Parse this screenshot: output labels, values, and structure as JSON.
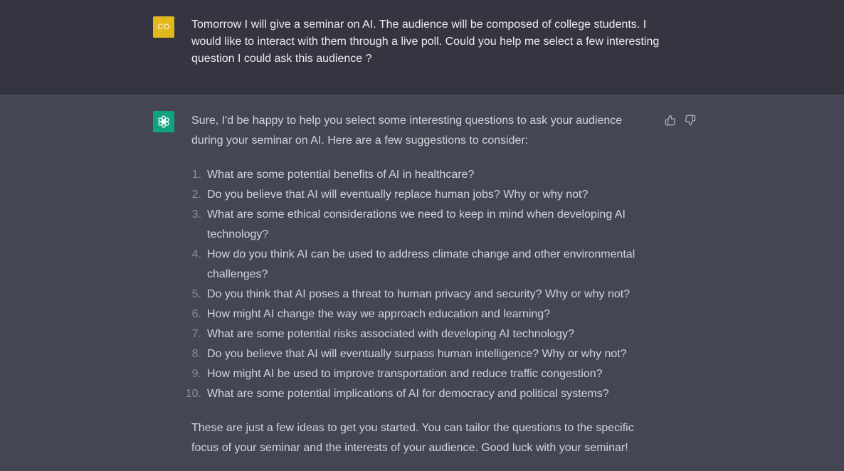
{
  "user_message": {
    "avatar_initials": "CO",
    "avatar_color": "#e3b81c",
    "text": "Tomorrow I will give a seminar on AI. The audience will be composed of college students. I would like to interact with them through a live poll. Could you help me select a few interesting question I could ask this audience ?"
  },
  "assistant_message": {
    "avatar_icon": "openai-logo-icon",
    "avatar_color": "#10a37f",
    "intro": "Sure, I'd be happy to help you select some interesting questions to ask your audience during your seminar on AI. Here are a few suggestions to consider:",
    "questions": [
      {
        "num": "1.",
        "text": "What are some potential benefits of AI in healthcare?"
      },
      {
        "num": "2.",
        "text": "Do you believe that AI will eventually replace human jobs? Why or why not?"
      },
      {
        "num": "3.",
        "text": "What are some ethical considerations we need to keep in mind when developing AI technology?"
      },
      {
        "num": "4.",
        "text": "How do you think AI can be used to address climate change and other environmental challenges?"
      },
      {
        "num": "5.",
        "text": "Do you think that AI poses a threat to human privacy and security? Why or why not?"
      },
      {
        "num": "6.",
        "text": "How might AI change the way we approach education and learning?"
      },
      {
        "num": "7.",
        "text": "What are some potential risks associated with developing AI technology?"
      },
      {
        "num": "8.",
        "text": "Do you believe that AI will eventually surpass human intelligence? Why or why not?"
      },
      {
        "num": "9.",
        "text": "How might AI be used to improve transportation and reduce traffic congestion?"
      },
      {
        "num": "10.",
        "text": "What are some potential implications of AI for democracy and political systems?"
      }
    ],
    "outro": "These are just a few ideas to get you started. You can tailor the questions to the specific focus of your seminar and the interests of your audience. Good luck with your seminar!"
  },
  "actions": {
    "thumbs_up_icon": "thumbs-up-icon",
    "thumbs_down_icon": "thumbs-down-icon"
  },
  "colors": {
    "user_bg": "#343541",
    "assistant_bg": "#444654",
    "text_user": "#ececf1",
    "text_assistant": "#d1d5db"
  }
}
